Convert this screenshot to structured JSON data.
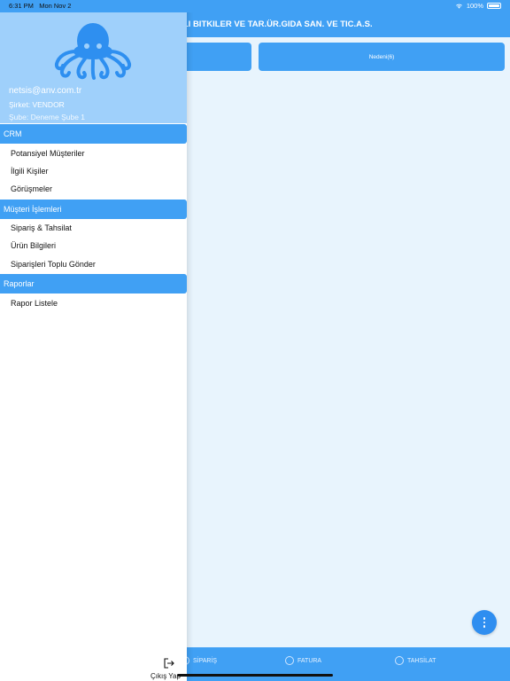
{
  "status_bar": {
    "time": "6:31 PM",
    "date": "Mon Nov 2",
    "battery": "100%"
  },
  "header": {
    "title": "ALI BITKILER VE TAR.ÜR.GIDA SAN. VE TIC.A.S."
  },
  "tabs": [
    {
      "label": ""
    },
    {
      "label": "Nedeni(6)"
    }
  ],
  "profile": {
    "email": "netsis@anv.com.tr",
    "company": "Şirket: VENDOR",
    "branch": "Şube: Deneme Şube 1"
  },
  "drawer": {
    "sections": [
      {
        "title": "CRM",
        "items": [
          "Potansiyel Müşteriler",
          "İlgili Kişiler",
          "Görüşmeler"
        ]
      },
      {
        "title": "Müşteri İşlemleri",
        "items": [
          "Sipariş & Tahsilat",
          "Ürün Bilgileri",
          "Siparişleri Toplu Gönder"
        ]
      },
      {
        "title": "Raporlar",
        "items": [
          "Rapor Listele"
        ]
      }
    ],
    "logout_label": "Çıkış Yap"
  },
  "bottom_tabs": [
    {
      "label": "SİPARİŞ",
      "icon": "cart-icon"
    },
    {
      "label": "FATURA",
      "icon": "invoice-icon"
    },
    {
      "label": "TAHSİLAT",
      "icon": "payment-icon"
    }
  ],
  "colors": {
    "primary": "#40a0f4",
    "profile_bg": "#9fd0fb",
    "content_bg": "#e8f4fd"
  }
}
